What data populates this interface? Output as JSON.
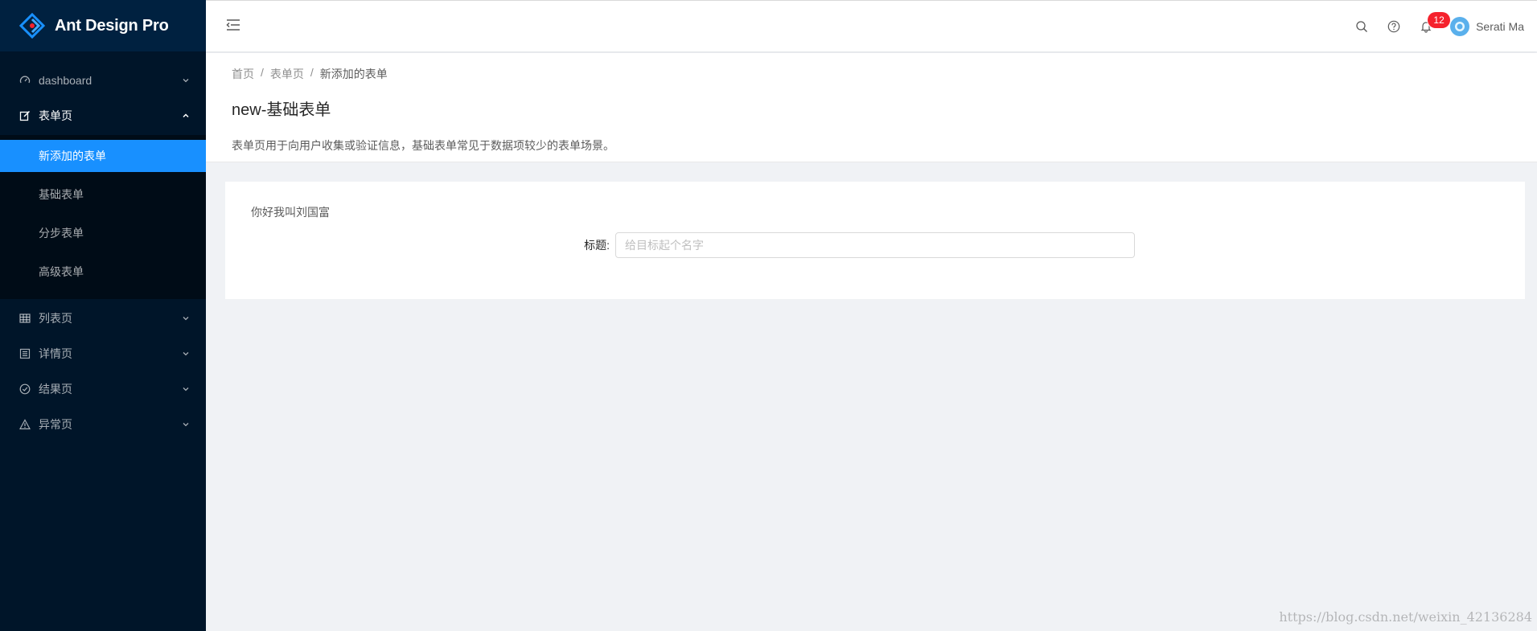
{
  "app": {
    "title": "Ant Design Pro"
  },
  "sidebar": {
    "items": [
      {
        "label": "dashboard",
        "icon": "dashboard-icon"
      },
      {
        "label": "表单页",
        "icon": "form-icon",
        "open": true,
        "children": [
          "新添加的表单",
          "基础表单",
          "分步表单",
          "高级表单"
        ],
        "active_child": "新添加的表单"
      },
      {
        "label": "列表页",
        "icon": "table-icon"
      },
      {
        "label": "详情页",
        "icon": "profile-icon"
      },
      {
        "label": "结果页",
        "icon": "check-circle-icon"
      },
      {
        "label": "异常页",
        "icon": "warning-icon"
      }
    ]
  },
  "header": {
    "notification_count": "12",
    "username": "Serati Ma"
  },
  "page_header": {
    "breadcrumb": [
      "首页",
      "表单页",
      "新添加的表单"
    ],
    "separator": "/",
    "title": "new-基础表单",
    "description": "表单页用于向用户收集或验证信息，基础表单常见于数据项较少的表单场景。"
  },
  "content": {
    "greeting": "你好我叫刘国富",
    "form": {
      "title_label": "标题:",
      "title_placeholder": "给目标起个名字",
      "title_value": ""
    }
  },
  "watermark": "https://blog.csdn.net/weixin_42136284",
  "colors": {
    "sider_bg": "#001529",
    "logo_bg": "#002140",
    "primary": "#1890ff",
    "badge": "#f5222d"
  }
}
